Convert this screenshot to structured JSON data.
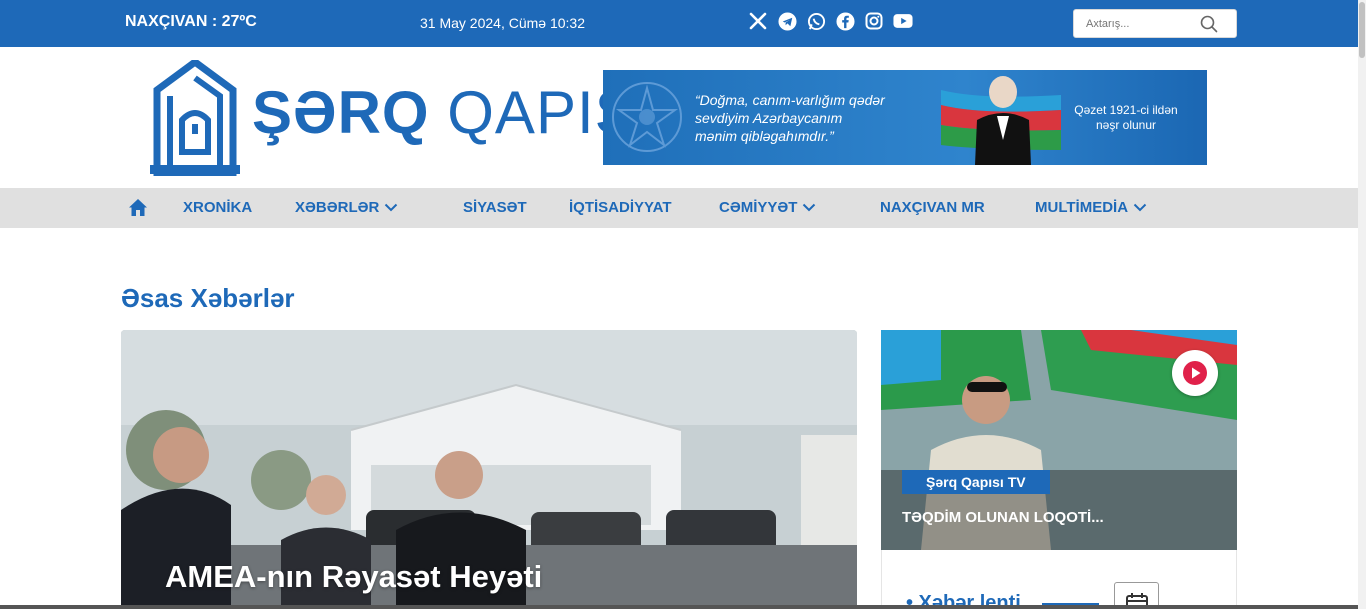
{
  "topbar": {
    "weather": "NAXÇIVAN : 27ºC",
    "datetime": "31 May 2024, Cümə 10:32",
    "socials": [
      "x-icon",
      "telegram-icon",
      "whatsapp-icon",
      "facebook-icon",
      "instagram-icon",
      "youtube-icon"
    ],
    "search_placeholder": "Axtarış..."
  },
  "header": {
    "logo_bold": "ŞƏRQ",
    "logo_light": " QAPISI",
    "banner_quote_line1": "“Doğma, canım-varlığım qədər",
    "banner_quote_line2": "sevdiyim Azərbaycanım",
    "banner_quote_line3": "mənim qibləgahımdır.”",
    "banner_since_line1": "Qəzet 1921-ci ildən",
    "banner_since_line2": "nəşr olunur"
  },
  "nav": {
    "items": [
      {
        "label": "XRONİKA"
      },
      {
        "label": "XƏBƏRLƏR"
      },
      {
        "label": "SİYASƏT"
      },
      {
        "label": "İQTİSADİYYAT"
      },
      {
        "label": "CƏMİYYƏT"
      },
      {
        "label": "NAXÇIVAN MR"
      },
      {
        "label": "MULTİMEDİA"
      }
    ]
  },
  "main": {
    "section_title": "Əsas Xəbərlər",
    "hero_headline": "AMEA-nın Rəyasət Heyəti",
    "tv_card": {
      "badge": "Şərq Qapısı TV",
      "title": "TƏQDİM OLUNAN LOQOTİ..."
    },
    "feed_title": "• Xəbər lenti"
  },
  "colors": {
    "brand": "#1e69b8",
    "nav_bg": "#e0e0e0"
  }
}
